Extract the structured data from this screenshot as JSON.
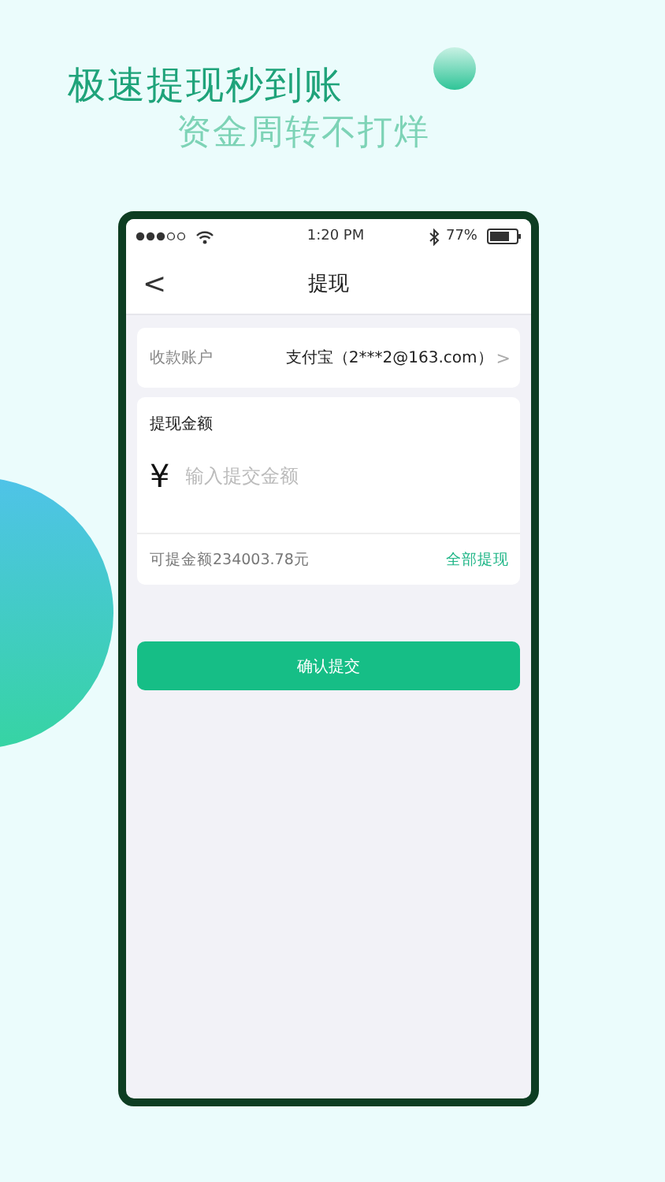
{
  "headline": "极速提现秒到账",
  "subheadline": "资金周转不打烊",
  "status_bar": {
    "time": "1:20 PM",
    "battery": "77%"
  },
  "nav_bar": {
    "back": "<",
    "title": "提现"
  },
  "account_row": {
    "label": "收款账户",
    "value": "支付宝（2***2@163.com）",
    "chevron": ">"
  },
  "amount_card": {
    "title": "提现金额",
    "currency": "¥",
    "placeholder": "输入提交金额",
    "available": "可提金额234003.78元",
    "withdraw_all": "全部提现"
  },
  "submit_button": "确认提交"
}
